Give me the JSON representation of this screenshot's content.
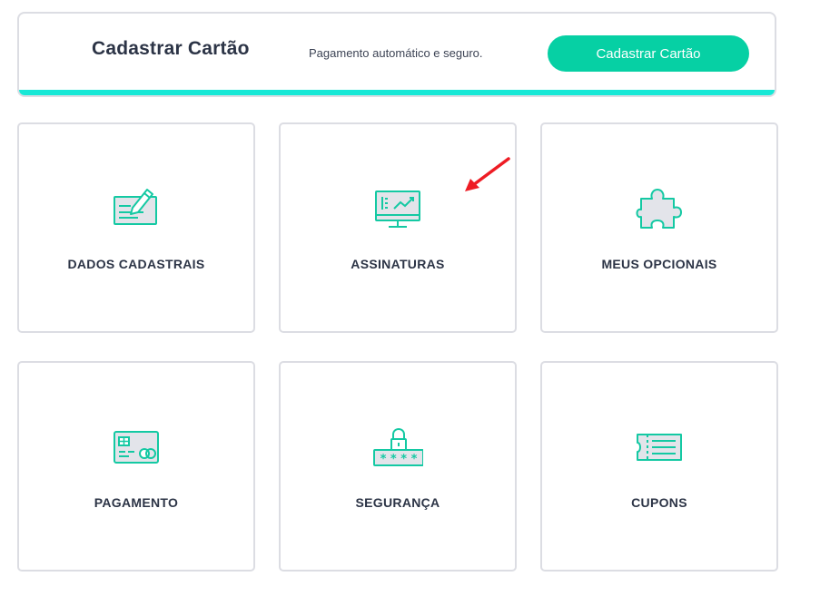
{
  "banner": {
    "title": "Cadastrar Cartão",
    "subtitle": "Pagamento automático e seguro.",
    "button_label": "Cadastrar Cartão"
  },
  "colors": {
    "accent": "#06d0a4",
    "accent_bar": "#17e8d6",
    "icon_stroke": "#14c9a3",
    "icon_fill": "#e3e4ea",
    "text": "#2c3446",
    "border": "#dcdde3",
    "arrow": "#ee1c24"
  },
  "cards": [
    {
      "label": "DADOS CADASTRAIS",
      "icon": "pencil-form-icon"
    },
    {
      "label": "ASSINATURAS",
      "icon": "monitor-chart-icon"
    },
    {
      "label": "MEUS OPCIONAIS",
      "icon": "puzzle-piece-icon"
    },
    {
      "label": "PAGAMENTO",
      "icon": "credit-card-icon"
    },
    {
      "label": "SEGURANÇA",
      "icon": "lock-password-icon"
    },
    {
      "label": "CUPONS",
      "icon": "ticket-icon"
    }
  ]
}
